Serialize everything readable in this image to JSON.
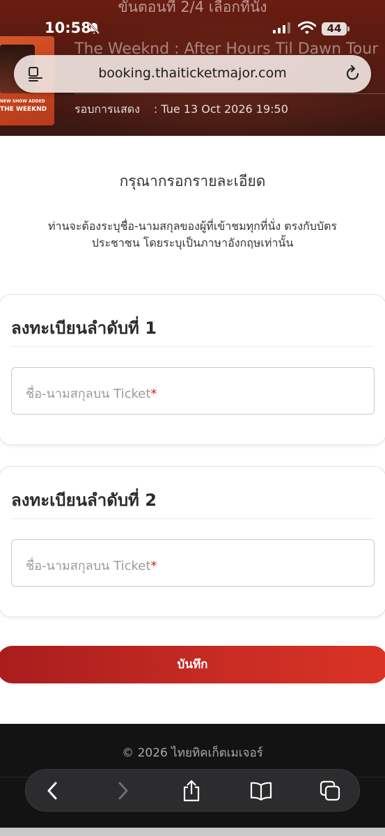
{
  "header": {
    "step_text": "ขั้นตอนที่ 2/4 เลือกที่นั่ง",
    "status_time": "10:58",
    "battery": "44",
    "event_title": "The Weeknd : After Hours Til Dawn Tour",
    "show_label": "รอบการแสดง",
    "show_value": ": Tue 13 Oct 2026 19:50",
    "poster_tag": "NEW SHOW ADDED",
    "poster_name": "THE WEEKND"
  },
  "browser": {
    "url": "booking.thaiticketmajor.com"
  },
  "form": {
    "title": "กรุณากรอกรายละเอียด",
    "instructions": "ท่านจะต้องระบุชื่อ-นามสกุลของผู้ที่เข้าชมทุกที่นั่ง ตรงกับบัตรประชาชน โดยระบุเป็นภาษาอังกฤษเท่านั้น",
    "cards": [
      {
        "title": "ลงทะเบียนลำดับที่ 1",
        "placeholder": "ชื่อ-นามสกุลบน Ticket",
        "required_mark": "*"
      },
      {
        "title": "ลงทะเบียนลำดับที่ 2",
        "placeholder": "ชื่อ-นามสกุลบน Ticket",
        "required_mark": "*"
      }
    ],
    "save_label": "บันทึก"
  },
  "footer": {
    "copyright": "© 2026 ไทยทิคเก็ตเมเจอร์"
  },
  "icons": {
    "menu": "reader-menu-icon",
    "reload": "reload-icon",
    "back": "back-icon",
    "forward": "forward-icon",
    "share": "share-icon",
    "bookmarks": "bookmarks-icon",
    "tabs": "tabs-icon"
  },
  "colors": {
    "accent": "#c62b23",
    "required": "#d32020",
    "footer_bg": "#131313"
  }
}
